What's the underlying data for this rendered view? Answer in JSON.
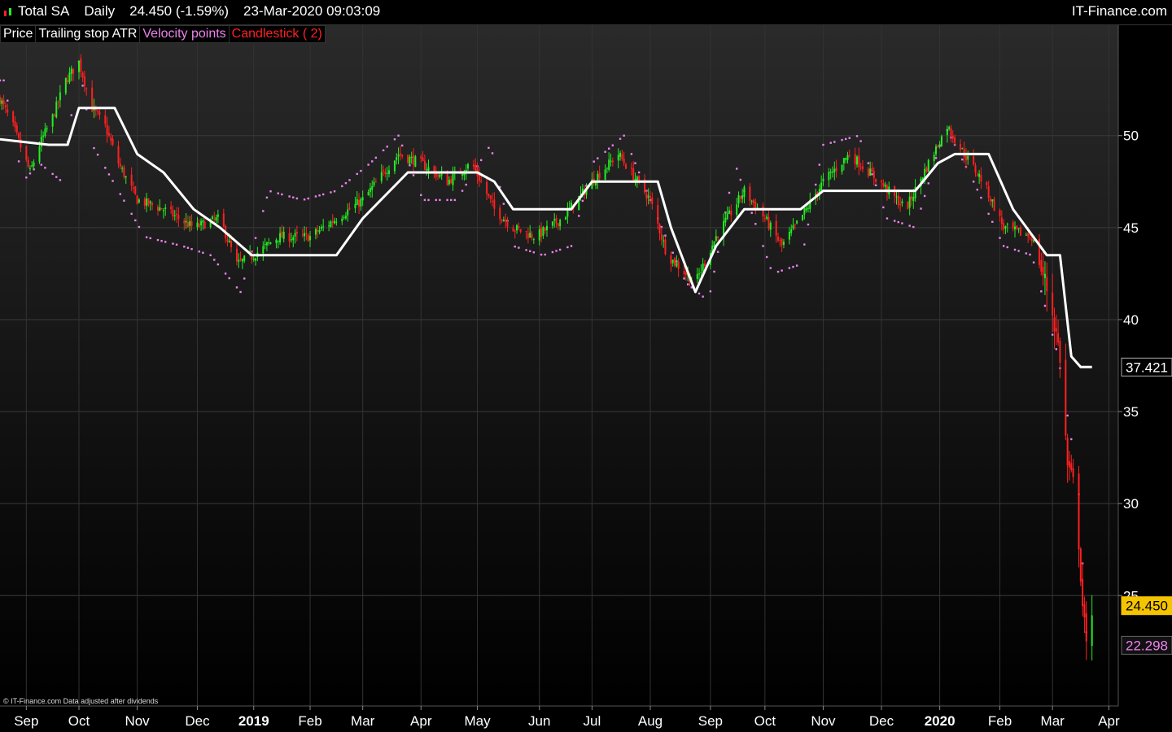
{
  "header": {
    "symbol": "Total SA",
    "period": "Daily",
    "price": "24.450 (-1.59%)",
    "datetime": "23-Mar-2020 09:03:09",
    "brand": "IT-Finance.com"
  },
  "legend": {
    "price": "Price",
    "trailing": "Trailing stop ATR",
    "velocity": "Velocity points",
    "candlestick": "Candlestick ( 2)"
  },
  "colors": {
    "background_top": "#2a2a2a",
    "background_bottom": "#000000",
    "up_candle": "#22ee22",
    "down_candle": "#ff2020",
    "trailing_stop": "#ffffff",
    "velocity_points": "#ee82ee",
    "last_price_tag": "#f5c400"
  },
  "footer": {
    "copyright": "© IT-Finance.com  Data adjusted after dividends"
  },
  "chart_data": {
    "type": "candlestick",
    "y_axis": {
      "ticks": [
        25,
        30,
        35,
        40,
        45,
        50
      ],
      "range": [
        19,
        56
      ],
      "side": "right",
      "grid": true
    },
    "x_axis": {
      "ticks": [
        "Sep",
        "Oct",
        "Nov",
        "Dec",
        "2019",
        "Feb",
        "Mar",
        "Apr",
        "May",
        "Jun",
        "Jul",
        "Aug",
        "Sep",
        "Oct",
        "Nov",
        "Dec",
        "2020",
        "Feb",
        "Mar",
        "Apr"
      ],
      "bold_ticks": [
        "2019",
        "2020"
      ],
      "range": [
        "2018-08-20",
        "2020-04-06"
      ],
      "grid": true
    },
    "value_tags": {
      "trailing_stop_last": "37.421",
      "last_price": "24.450",
      "velocity_last": "22.298"
    },
    "series": [
      {
        "name": "Price",
        "kind": "close_path",
        "points": [
          [
            "2018-08-20",
            52.0
          ],
          [
            "2018-08-27",
            50.5
          ],
          [
            "2018-09-05",
            48.0
          ],
          [
            "2018-09-10",
            49.5
          ],
          [
            "2018-09-17",
            51.0
          ],
          [
            "2018-09-24",
            53.0
          ],
          [
            "2018-10-01",
            54.0
          ],
          [
            "2018-10-08",
            51.5
          ],
          [
            "2018-10-15",
            50.5
          ],
          [
            "2018-10-22",
            48.5
          ],
          [
            "2018-11-01",
            46.5
          ],
          [
            "2018-11-15",
            46.0
          ],
          [
            "2018-12-01",
            45.0
          ],
          [
            "2018-12-15",
            45.5
          ],
          [
            "2018-12-24",
            43.0
          ],
          [
            "2019-01-02",
            43.5
          ],
          [
            "2019-01-15",
            44.5
          ],
          [
            "2019-02-01",
            44.5
          ],
          [
            "2019-02-15",
            45.5
          ],
          [
            "2019-03-01",
            46.5
          ],
          [
            "2019-03-20",
            49.0
          ],
          [
            "2019-04-01",
            48.5
          ],
          [
            "2019-04-15",
            47.5
          ],
          [
            "2019-04-28",
            48.5
          ],
          [
            "2019-05-10",
            46.0
          ],
          [
            "2019-05-20",
            45.0
          ],
          [
            "2019-06-01",
            44.5
          ],
          [
            "2019-06-15",
            45.5
          ],
          [
            "2019-07-01",
            47.5
          ],
          [
            "2019-07-15",
            49.0
          ],
          [
            "2019-08-01",
            46.5
          ],
          [
            "2019-08-10",
            43.5
          ],
          [
            "2019-08-25",
            42.0
          ],
          [
            "2019-09-05",
            44.5
          ],
          [
            "2019-09-20",
            47.0
          ],
          [
            "2019-10-01",
            45.5
          ],
          [
            "2019-10-10",
            44.0
          ],
          [
            "2019-10-20",
            45.5
          ],
          [
            "2019-11-01",
            47.5
          ],
          [
            "2019-11-15",
            49.0
          ],
          [
            "2019-12-01",
            47.5
          ],
          [
            "2019-12-15",
            46.0
          ],
          [
            "2019-12-27",
            48.5
          ],
          [
            "2020-01-06",
            50.5
          ],
          [
            "2020-01-15",
            49.0
          ],
          [
            "2020-01-25",
            47.5
          ],
          [
            "2020-02-05",
            45.0
          ],
          [
            "2020-02-20",
            44.5
          ],
          [
            "2020-03-01",
            41.0
          ],
          [
            "2020-03-06",
            38.0
          ],
          [
            "2020-03-10",
            32.0
          ],
          [
            "2020-03-13",
            31.0
          ],
          [
            "2020-03-16",
            28.0
          ],
          [
            "2020-03-18",
            24.5
          ],
          [
            "2020-03-20",
            22.0
          ],
          [
            "2020-03-23",
            24.45
          ]
        ]
      },
      {
        "name": "Trailing stop ATR",
        "kind": "step",
        "points": [
          [
            "2018-08-20",
            49.8
          ],
          [
            "2018-09-15",
            49.5
          ],
          [
            "2018-09-25",
            49.5
          ],
          [
            "2018-10-01",
            51.5
          ],
          [
            "2018-10-20",
            51.5
          ],
          [
            "2018-11-01",
            49.0
          ],
          [
            "2018-11-15",
            48.0
          ],
          [
            "2018-12-01",
            46.0
          ],
          [
            "2018-12-15",
            45.0
          ],
          [
            "2019-01-01",
            43.5
          ],
          [
            "2019-02-15",
            43.5
          ],
          [
            "2019-03-01",
            45.5
          ],
          [
            "2019-03-25",
            48.0
          ],
          [
            "2019-05-01",
            48.0
          ],
          [
            "2019-05-10",
            47.5
          ],
          [
            "2019-05-20",
            46.0
          ],
          [
            "2019-06-20",
            46.0
          ],
          [
            "2019-07-01",
            47.5
          ],
          [
            "2019-08-05",
            47.5
          ],
          [
            "2019-08-12",
            45.0
          ],
          [
            "2019-08-25",
            41.5
          ],
          [
            "2019-09-05",
            44.0
          ],
          [
            "2019-09-20",
            46.0
          ],
          [
            "2019-10-20",
            46.0
          ],
          [
            "2019-11-01",
            47.0
          ],
          [
            "2019-12-20",
            47.0
          ],
          [
            "2020-01-01",
            48.5
          ],
          [
            "2020-01-10",
            49.0
          ],
          [
            "2020-01-28",
            49.0
          ],
          [
            "2020-02-10",
            46.0
          ],
          [
            "2020-02-28",
            43.5
          ],
          [
            "2020-03-06",
            43.5
          ],
          [
            "2020-03-12",
            38.0
          ],
          [
            "2020-03-17",
            37.421
          ],
          [
            "2020-03-23",
            37.421
          ]
        ]
      },
      {
        "name": "Velocity points",
        "kind": "dots",
        "points": [
          [
            "2018-08-22",
            53.0
          ],
          [
            "2018-09-01",
            47.5
          ],
          [
            "2018-09-10",
            48.5
          ],
          [
            "2018-09-22",
            47.5
          ],
          [
            "2018-10-01",
            54.0
          ],
          [
            "2018-10-08",
            49.5
          ],
          [
            "2018-10-22",
            47.0
          ],
          [
            "2018-11-05",
            44.5
          ],
          [
            "2018-11-25",
            44.0
          ],
          [
            "2018-12-10",
            43.5
          ],
          [
            "2018-12-26",
            41.5
          ],
          [
            "2019-01-10",
            47.0
          ],
          [
            "2019-01-28",
            46.5
          ],
          [
            "2019-02-15",
            47.0
          ],
          [
            "2019-03-05",
            48.5
          ],
          [
            "2019-03-20",
            50.0
          ],
          [
            "2019-04-02",
            46.5
          ],
          [
            "2019-04-20",
            46.5
          ],
          [
            "2019-05-08",
            49.5
          ],
          [
            "2019-05-20",
            44.0
          ],
          [
            "2019-06-05",
            43.5
          ],
          [
            "2019-06-20",
            44.0
          ],
          [
            "2019-07-01",
            48.5
          ],
          [
            "2019-07-18",
            50.0
          ],
          [
            "2019-08-05",
            45.5
          ],
          [
            "2019-08-20",
            42.0
          ],
          [
            "2019-09-01",
            41.0
          ],
          [
            "2019-09-15",
            48.5
          ],
          [
            "2019-10-05",
            42.5
          ],
          [
            "2019-10-20",
            43.0
          ],
          [
            "2019-11-01",
            49.5
          ],
          [
            "2019-11-20",
            50.0
          ],
          [
            "2019-12-05",
            45.5
          ],
          [
            "2019-12-20",
            45.0
          ],
          [
            "2020-01-05",
            50.5
          ],
          [
            "2020-01-20",
            47.5
          ],
          [
            "2020-02-05",
            44.0
          ],
          [
            "2020-02-20",
            43.5
          ],
          [
            "2020-03-05",
            38.0
          ],
          [
            "2020-03-12",
            33.5
          ],
          [
            "2020-03-16",
            30.5
          ],
          [
            "2020-03-20",
            23.0
          ],
          [
            "2020-03-23",
            22.298
          ]
        ]
      }
    ]
  }
}
